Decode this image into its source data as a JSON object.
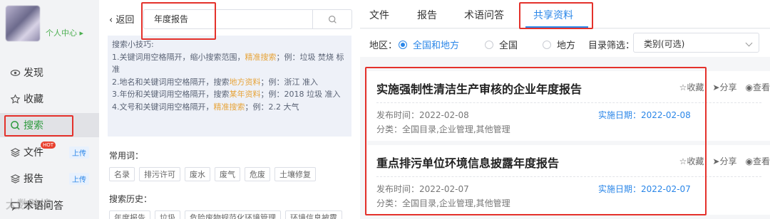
{
  "sidebar": {
    "profile_link": "个人中心 ▸",
    "items": [
      {
        "label": "发现"
      },
      {
        "label": "收藏"
      },
      {
        "label": "搜索"
      },
      {
        "label": "文件",
        "badge": "HOT",
        "tag": "上传"
      },
      {
        "label": "报告",
        "tag": "上传"
      },
      {
        "label": "术语问答"
      }
    ]
  },
  "watermark": "大数跨境",
  "search": {
    "back_label": "返回",
    "query": "年度报告",
    "tips": {
      "title": "搜索小技巧:",
      "lines": [
        {
          "pre": "1.关键词用空格隔开，缩小搜索范围，",
          "hl": "精准搜索",
          "post": "；例：垃圾 焚烧 标准"
        },
        {
          "pre": "2.地名和关键词用空格隔开，搜索",
          "hl": "地方资料",
          "post": "；例：浙江 准入"
        },
        {
          "pre": "3.年份和关键词用空格隔开，搜索",
          "hl": "某年资料",
          "post": "；例：2018 垃圾 准入"
        },
        {
          "pre": "4.文号和关键词用空格隔开，",
          "hl": "精准搜索",
          "post": "；例：2.2 大气"
        }
      ]
    },
    "common_label": "常用词：",
    "common_terms": [
      "名录",
      "排污许可",
      "废水",
      "废气",
      "危废",
      "土壤修复"
    ],
    "history_label": "搜索历史：",
    "history_terms": [
      "年度报告",
      "垃圾",
      "危险废物规范化环境管理",
      "环境信息披露"
    ]
  },
  "tabs": [
    "文件",
    "报告",
    "术语问答",
    "共享资料"
  ],
  "active_tab": "共享资料",
  "filter": {
    "region_label": "地区：",
    "regions": [
      "全国和地方",
      "全国",
      "地方"
    ],
    "selected_region": "全国和地方",
    "catalog_label": "目录筛选：",
    "catalog_value": "类别(可选)"
  },
  "actions": {
    "favorite": "收藏",
    "share": "分享",
    "view": "查看"
  },
  "results": [
    {
      "title": "实施强制性清洁生产审核的企业年度报告",
      "publish": "发布时间：2022-02-08",
      "effective": "实施日期：2022-02-08",
      "category": "分类：全国目录,企业管理,其他管理"
    },
    {
      "title": "重点排污单位环境信息披露年度报告",
      "publish": "发布时间：2022-02-07",
      "effective": "实施日期：2022-02-07",
      "category": "分类：全国目录,企业管理,其他管理"
    }
  ],
  "colors": {
    "accent_blue": "#2a86e8",
    "active_green": "#2e9a3e",
    "annotation_red": "#e4312b",
    "highlight_orange": "#e7a43a"
  }
}
